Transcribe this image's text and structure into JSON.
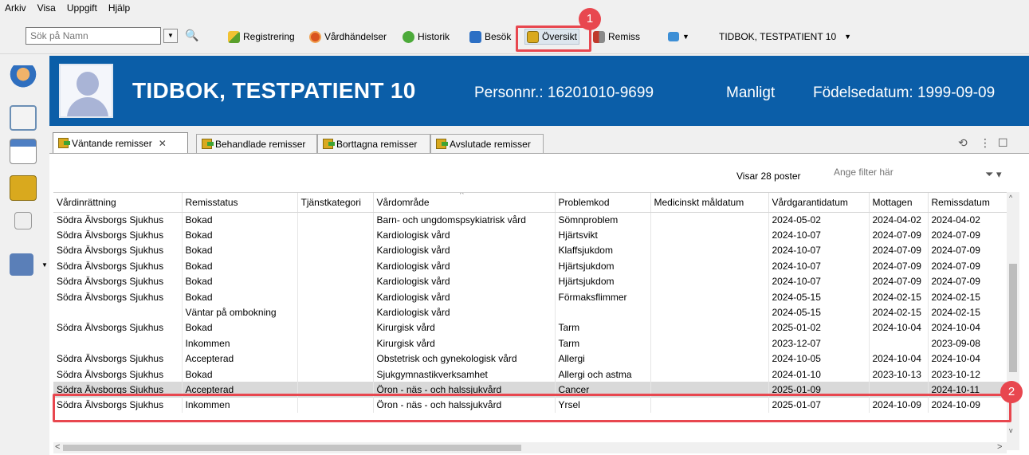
{
  "menu": [
    "Arkiv",
    "Visa",
    "Uppgift",
    "Hjälp"
  ],
  "search": {
    "placeholder": "Sök på Namn"
  },
  "toolbar": {
    "registrering": "Registrering",
    "vardhandelser": "Vårdhändelser",
    "historik": "Historik",
    "besok": "Besök",
    "oversikt": "Översikt",
    "remiss": "Remiss",
    "patient_selector": "TIDBOK, TESTPATIENT 10"
  },
  "callouts": {
    "one": "1",
    "two": "2"
  },
  "patient": {
    "name": "TIDBOK, TESTPATIENT 10",
    "personnr": "Personnr.: 16201010-9699",
    "gender": "Manligt",
    "birthdate": "Födelsedatum: 1999-09-09"
  },
  "tabs": [
    "Väntande remisser",
    "Behandlade remisser",
    "Borttagna remisser",
    "Avslutade remisser"
  ],
  "filter": {
    "count_text": "Visar 28 poster",
    "placeholder": "Ange filter här"
  },
  "table": {
    "columns": [
      "Vårdinrättning",
      "Remisstatus",
      "Tjänstkategori",
      "Vårdområde",
      "Problemkod",
      "Medicinskt måldatum",
      "Vårdgarantidatum",
      "Mottagen",
      "Remissdatum"
    ],
    "rows": [
      [
        "Södra Älvsborgs Sjukhus",
        "Bokad",
        "",
        "Barn- och ungdomspsykiatrisk vård",
        "Sömnproblem",
        "",
        "2024-05-02",
        "2024-04-02",
        "2024-04-02"
      ],
      [
        "Södra Älvsborgs Sjukhus",
        "Bokad",
        "",
        "Kardiologisk vård",
        "Hjärtsvikt",
        "",
        "2024-10-07",
        "2024-07-09",
        "2024-07-09"
      ],
      [
        "Södra Älvsborgs Sjukhus",
        "Bokad",
        "",
        "Kardiologisk vård",
        "Klaffsjukdom",
        "",
        "2024-10-07",
        "2024-07-09",
        "2024-07-09"
      ],
      [
        "Södra Älvsborgs Sjukhus",
        "Bokad",
        "",
        "Kardiologisk vård",
        "Hjärtsjukdom",
        "",
        "2024-10-07",
        "2024-07-09",
        "2024-07-09"
      ],
      [
        "Södra Älvsborgs Sjukhus",
        "Bokad",
        "",
        "Kardiologisk vård",
        "Hjärtsjukdom",
        "",
        "2024-10-07",
        "2024-07-09",
        "2024-07-09"
      ],
      [
        "Södra Älvsborgs Sjukhus",
        "Bokad",
        "",
        "Kardiologisk vård",
        "Förmaksflimmer",
        "",
        "2024-05-15",
        "2024-02-15",
        "2024-02-15"
      ],
      [
        "",
        "Väntar på ombokning",
        "",
        "Kardiologisk vård",
        "",
        "",
        "2024-05-15",
        "2024-02-15",
        "2024-02-15"
      ],
      [
        "Södra Älvsborgs Sjukhus",
        "Bokad",
        "",
        "Kirurgisk vård",
        "Tarm",
        "",
        "2025-01-02",
        "2024-10-04",
        "2024-10-04"
      ],
      [
        "",
        "Inkommen",
        "",
        "Kirurgisk vård",
        "Tarm",
        "",
        "2023-12-07",
        "",
        "2023-09-08"
      ],
      [
        "Södra Älvsborgs Sjukhus",
        "Accepterad",
        "",
        "Obstetrisk och gynekologisk vård",
        "Allergi",
        "",
        "2024-10-05",
        "2024-10-04",
        "2024-10-04"
      ],
      [
        "Södra Älvsborgs Sjukhus",
        "Bokad",
        "",
        "Sjukgymnastikverksamhet",
        "Allergi och astma",
        "",
        "2024-01-10",
        "2023-10-13",
        "2023-10-12"
      ],
      [
        "Södra Älvsborgs Sjukhus",
        "Accepterad",
        "",
        "Öron - näs - och halssjukvård",
        "Cancer",
        "",
        "2025-01-09",
        "",
        "2024-10-11"
      ],
      [
        "Södra Älvsborgs Sjukhus",
        "Inkommen",
        "",
        "Öron - näs - och halssjukvård",
        "Yrsel",
        "",
        "2025-01-07",
        "2024-10-09",
        "2024-10-09"
      ]
    ]
  }
}
